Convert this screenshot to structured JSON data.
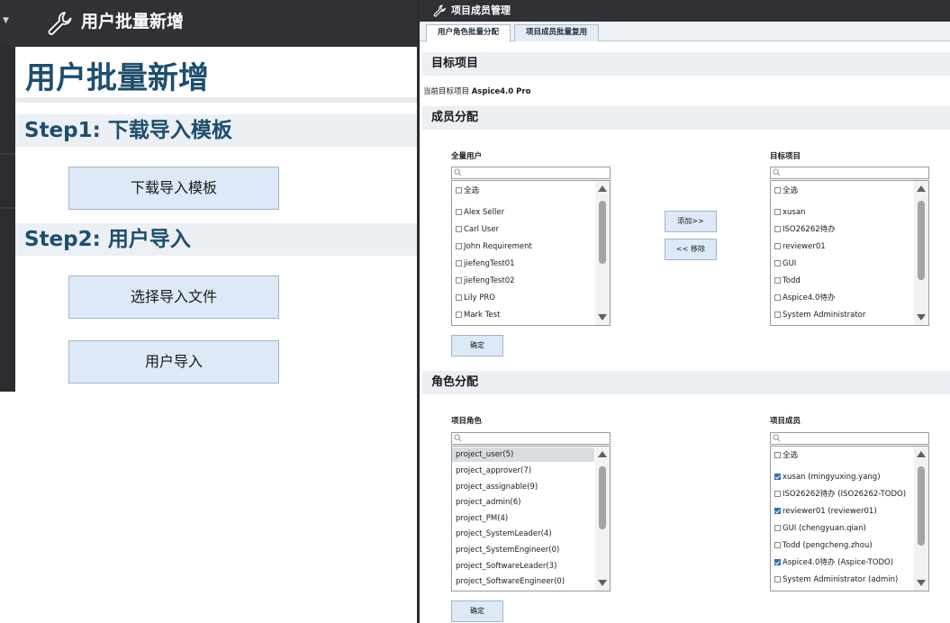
{
  "left": {
    "header_title": "用户批量新增",
    "page_title": "用户批量新增",
    "step1_title": "Step1: 下载导入模板",
    "download_button": "下载导入模板",
    "step2_title": "Step2: 用户导入",
    "choose_file_button": "选择导入文件",
    "import_button": "用户导入"
  },
  "right": {
    "header_title": "项目成员管理",
    "tabs": [
      {
        "label": "用户角色批量分配",
        "active": true
      },
      {
        "label": "项目成员批量复用",
        "active": false
      }
    ],
    "target_section": {
      "title": "目标项目",
      "info_prefix": "当前目标项目",
      "project_name": "Aspice4.0 Pro"
    },
    "member_section": {
      "title": "成员分配",
      "all_users": {
        "label": "全量用户",
        "search_placeholder": "",
        "select_all": "全选",
        "items": [
          "Alex Seller",
          "Carl User",
          "John Requirement",
          "jiefengTest01",
          "jiefengTest02",
          "Lily PRO",
          "Mark Test"
        ]
      },
      "target_project": {
        "label": "目标项目",
        "search_placeholder": "",
        "select_all": "全选",
        "items": [
          "xusan",
          "ISO26262待办",
          "reviewer01",
          "GUI",
          "Todd",
          "Aspice4.0待办",
          "System Administrator"
        ]
      },
      "add_button": "添加>>",
      "remove_button": "<< 移除",
      "confirm_button": "确定"
    },
    "role_section": {
      "title": "角色分配",
      "project_roles": {
        "label": "项目角色",
        "search_placeholder": "",
        "selected_index": 0,
        "items": [
          "project_user(5)",
          "project_approver(7)",
          "project_assignable(9)",
          "project_admin(6)",
          "project_PM(4)",
          "project_SystemLeader(4)",
          "project_SystemEngineer(0)",
          "project_SoftwareLeader(3)",
          "project_SoftwareEngineer(0)"
        ]
      },
      "project_members": {
        "label": "项目成员",
        "search_placeholder": "",
        "select_all": "全选",
        "items": [
          {
            "label": "xusan (mingyuxing.yang)",
            "checked": true
          },
          {
            "label": "ISO26262待办 (ISO26262-TODO)",
            "checked": false
          },
          {
            "label": "reviewer01 (reviewer01)",
            "checked": true
          },
          {
            "label": "GUI (chengyuan.qian)",
            "checked": false
          },
          {
            "label": "Todd (pengcheng.zhou)",
            "checked": false
          },
          {
            "label": "Aspice4.0待办 (Aspice-TODO)",
            "checked": true
          },
          {
            "label": "System Administrator (admin)",
            "checked": false
          }
        ]
      },
      "confirm_button": "确定"
    }
  },
  "icons": [
    "wrench-icon",
    "search-icon",
    "caret-down-icon",
    "scroll-up-icon",
    "scroll-down-icon"
  ]
}
